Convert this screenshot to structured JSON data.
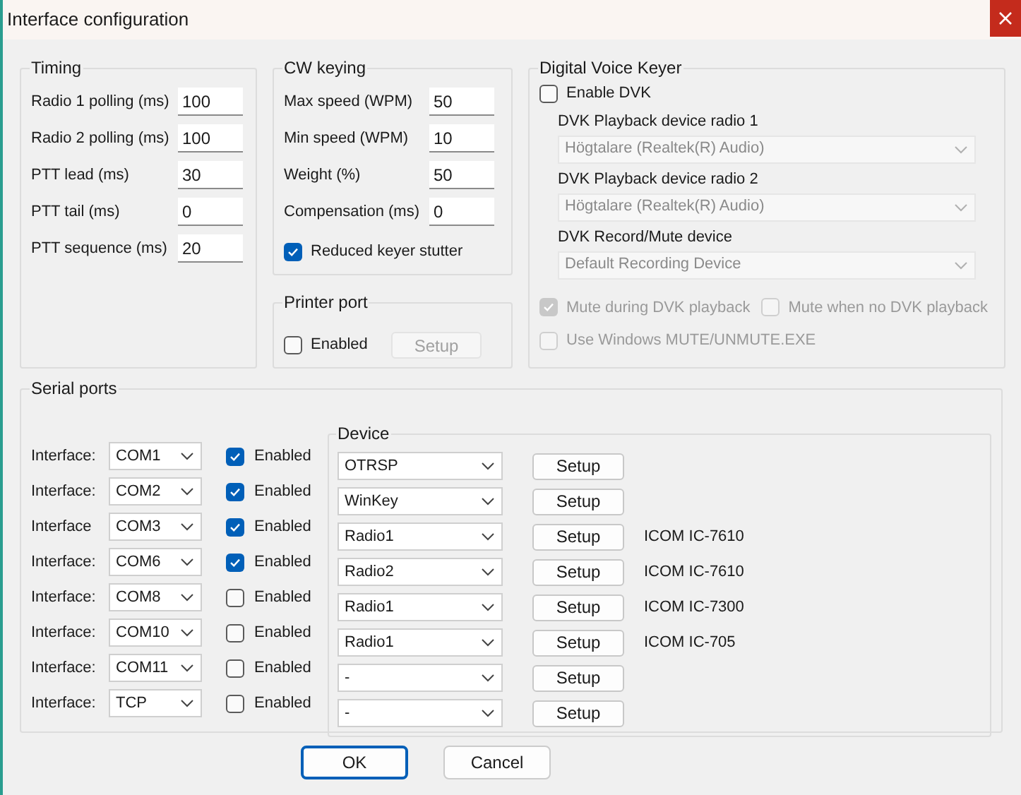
{
  "window": {
    "title": "Interface configuration"
  },
  "timing": {
    "title": "Timing",
    "fields": [
      {
        "label": "Radio 1 polling (ms)",
        "value": "100"
      },
      {
        "label": "Radio 2 polling (ms)",
        "value": "100"
      },
      {
        "label": "PTT lead (ms)",
        "value": "30"
      },
      {
        "label": "PTT tail (ms)",
        "value": "0"
      },
      {
        "label": "PTT sequence (ms)",
        "value": "20"
      }
    ]
  },
  "cw_keying": {
    "title": "CW keying",
    "fields": [
      {
        "label": "Max speed (WPM)",
        "value": "50"
      },
      {
        "label": "Min speed (WPM)",
        "value": "10"
      },
      {
        "label": "Weight (%)",
        "value": "50"
      },
      {
        "label": "Compensation (ms)",
        "value": "0"
      }
    ],
    "checkbox": {
      "label": "Reduced keyer stutter",
      "checked": true
    }
  },
  "printer_port": {
    "title": "Printer port",
    "checkbox": {
      "label": "Enabled",
      "checked": false
    },
    "setup_button": {
      "label": "Setup",
      "disabled": true
    }
  },
  "dvk": {
    "title": "Digital Voice Keyer",
    "enable": {
      "label": "Enable DVK",
      "checked": false
    },
    "selects": [
      {
        "label": "DVK Playback device radio 1",
        "value": "Högtalare (Realtek(R) Audio)",
        "disabled": true
      },
      {
        "label": "DVK Playback device radio 2",
        "value": "Högtalare (Realtek(R) Audio)",
        "disabled": true
      },
      {
        "label": "DVK Record/Mute device",
        "value": "Default Recording Device",
        "disabled": true
      }
    ],
    "options": [
      {
        "label": "Mute during DVK playback",
        "checked": true,
        "disabled": true
      },
      {
        "label": "Mute when no DVK playback",
        "checked": false,
        "disabled": true
      },
      {
        "label": "Use Windows MUTE/UNMUTE.EXE",
        "checked": false,
        "disabled": true
      }
    ]
  },
  "serial_ports": {
    "title": "Serial ports",
    "device_title": "Device",
    "rows": [
      {
        "label": "Interface:",
        "port": "COM1",
        "enabled": true,
        "enabled_label": "Enabled",
        "device": "OTRSP",
        "setup": "Setup"
      },
      {
        "label": "Interface:",
        "port": "COM2",
        "enabled": true,
        "enabled_label": "Enabled",
        "device": "WinKey",
        "setup": "Setup"
      },
      {
        "label": "Interface",
        "port": "COM3",
        "enabled": true,
        "enabled_label": "Enabled",
        "device": "Radio1",
        "setup": "Setup",
        "model": "ICOM IC-7610"
      },
      {
        "label": "Interface:",
        "port": "COM6",
        "enabled": true,
        "enabled_label": "Enabled",
        "device": "Radio2",
        "setup": "Setup",
        "model": "ICOM IC-7610"
      },
      {
        "label": "Interface:",
        "port": "COM8",
        "enabled": false,
        "enabled_label": "Enabled",
        "device": "Radio1",
        "setup": "Setup",
        "model": "ICOM IC-7300"
      },
      {
        "label": "Interface:",
        "port": "COM10",
        "enabled": false,
        "enabled_label": "Enabled",
        "device": "Radio1",
        "setup": "Setup",
        "model": "ICOM IC-705"
      },
      {
        "label": "Interface:",
        "port": "COM11",
        "enabled": false,
        "enabled_label": "Enabled",
        "device": "-",
        "setup": "Setup"
      },
      {
        "label": "Interface:",
        "port": "TCP",
        "enabled": false,
        "enabled_label": "Enabled",
        "device": "-",
        "setup": "Setup"
      }
    ]
  },
  "buttons": [
    {
      "label": "OK",
      "default": true
    },
    {
      "label": "Cancel",
      "default": false
    }
  ]
}
